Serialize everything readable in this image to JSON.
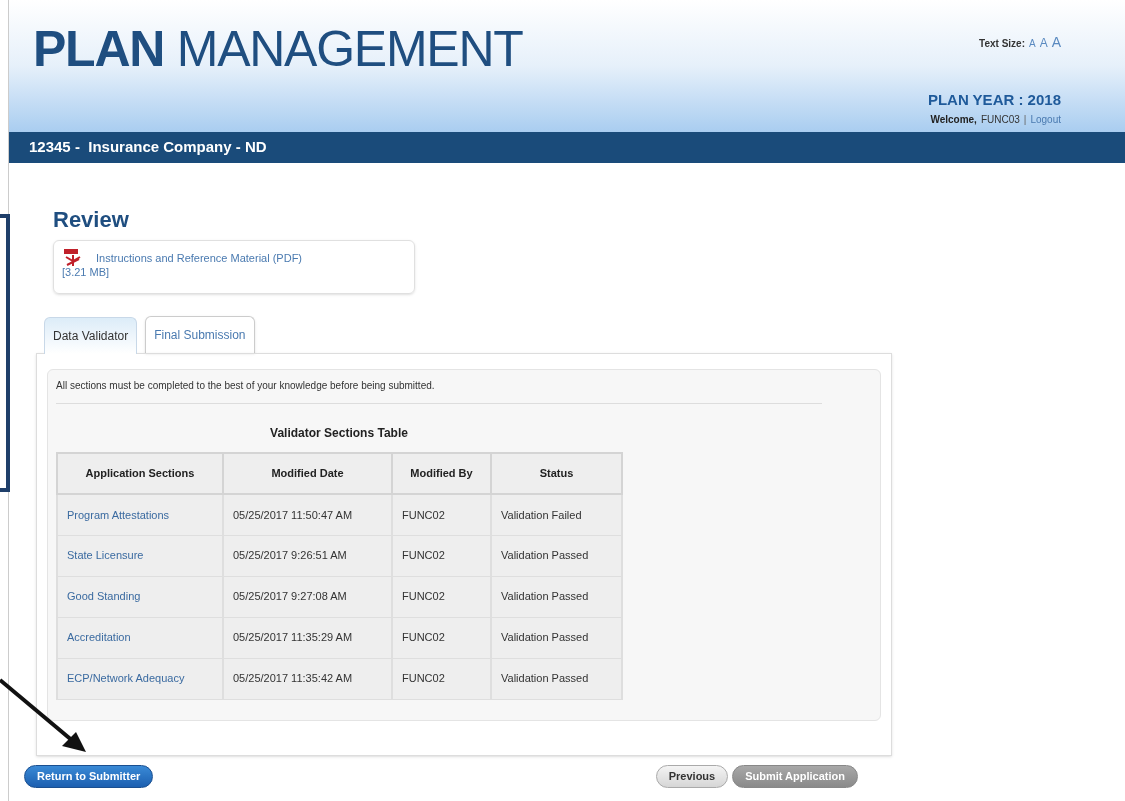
{
  "header": {
    "title_bold": "PLAN",
    "title_rest": "MANAGEMENT",
    "text_size_label": "Text Size:",
    "text_size_options": [
      "A",
      "A",
      "A"
    ],
    "plan_year": "PLAN YEAR : 2018",
    "welcome": "Welcome,",
    "user": "FUNC03",
    "separator": "|",
    "logout": "Logout"
  },
  "nav_bar": {
    "title": "12345 -  Insurance Company - ND"
  },
  "page_title": "Review",
  "document": {
    "link": "Instructions and Reference Material (PDF)",
    "size": "[3.21 MB]"
  },
  "tabs": [
    {
      "label": "Data Validator",
      "selected": true
    },
    {
      "label": "Final Submission",
      "selected": false
    }
  ],
  "notice": "All sections must be completed to the best of your knowledge before being submitted.",
  "table": {
    "caption": "Validator Sections Table",
    "columns": [
      "Application Sections",
      "Modified Date",
      "Modified By",
      "Status"
    ],
    "rows": [
      [
        "Program Attestations",
        "05/25/2017 11:50:47 AM",
        "FUNC02",
        "Validation Failed"
      ],
      [
        "State Licensure",
        "05/25/2017 9:26:51 AM",
        "FUNC02",
        "Validation Passed"
      ],
      [
        "Good Standing",
        "05/25/2017 9:27:08 AM",
        "FUNC02",
        "Validation Passed"
      ],
      [
        "Accreditation",
        "05/25/2017 11:35:29 AM",
        "FUNC02",
        "Validation Passed"
      ],
      [
        "ECP/Network Adequacy",
        "05/25/2017 11:35:42 AM",
        "FUNC02",
        "Validation Passed"
      ]
    ]
  },
  "buttons": [
    {
      "label": "Return to Submitter",
      "kind": "primary",
      "disabled": false
    },
    {
      "label": "Previous",
      "kind": "secondary",
      "disabled": false
    },
    {
      "label": "Submit Application",
      "kind": "secondary",
      "disabled": true
    }
  ]
}
